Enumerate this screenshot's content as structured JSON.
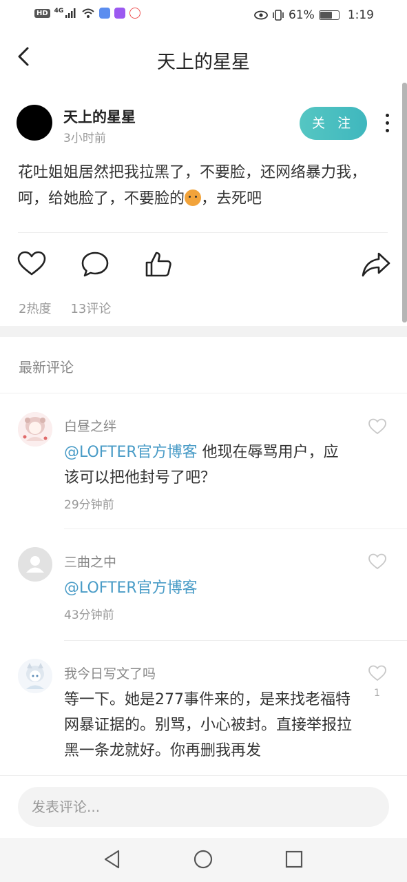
{
  "status_bar": {
    "hd": "HD",
    "network": "4G",
    "battery_percent": "61%",
    "battery_level": 0.61,
    "time": "1:19"
  },
  "header": {
    "title": "天上的星星"
  },
  "post": {
    "author_name": "天上的星星",
    "time_ago": "3小时前",
    "follow_label": "关 注",
    "text_part1": "花吐姐姐居然把我拉黑了，不要脸，还网络暴力我，呵，给她脸了，不要脸的",
    "text_part2": "，去死吧",
    "heat": "2热度",
    "comment_count": "13评论"
  },
  "comments_section": {
    "title": "最新评论"
  },
  "comments": [
    {
      "name": "白昼之绊",
      "mention": "@LOFTER官方博客",
      "text": " 他现在辱骂用户，应该可以把他封号了吧？",
      "time": "29分钟前",
      "likes": ""
    },
    {
      "name": "三曲之中",
      "mention": "@LOFTER官方博客",
      "text": "",
      "time": "43分钟前",
      "likes": ""
    },
    {
      "name": "我今日写文了吗",
      "mention": "",
      "text": "等一下。她是277事件来的，是来找老福特网暴证据的。别骂，小心被封。直接举报拉黑一条龙就好。你再删我再发",
      "time": "",
      "likes": "1"
    }
  ],
  "input": {
    "placeholder": "发表评论..."
  },
  "colors": {
    "accent": "#4ab9bf",
    "mention": "#4a9cc7"
  }
}
